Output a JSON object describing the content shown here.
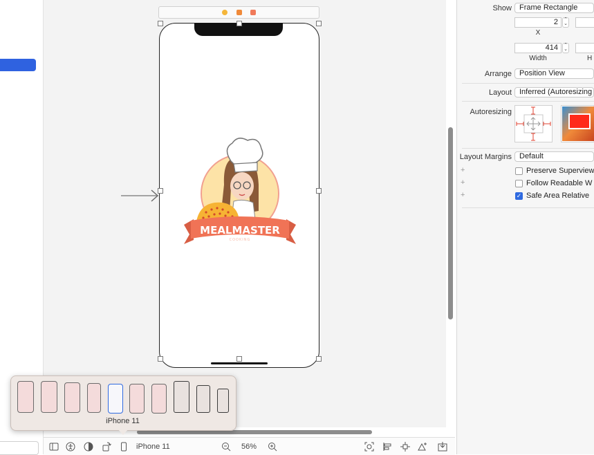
{
  "inspector": {
    "show_label": "Show",
    "show_value": "Frame Rectangle",
    "x_value": "2",
    "x_label": "X",
    "width_value": "414",
    "width_label": "Width",
    "arrange_label": "Arrange",
    "arrange_value": "Position View",
    "layout_label": "Layout",
    "layout_value": "Inferred (Autoresizing",
    "autoresizing_label": "Autoresizing",
    "layout_margins_label": "Layout Margins",
    "layout_margins_value": "Default",
    "checks": [
      {
        "label": "Preserve Superview",
        "checked": false
      },
      {
        "label": "Follow Readable W",
        "checked": false
      },
      {
        "label": "Safe Area Relative",
        "checked": true
      }
    ]
  },
  "canvas": {
    "logo_title": "MEALMASTER",
    "logo_subtitle": "COOKING"
  },
  "device_picker": {
    "selected_label": "iPhone 11"
  },
  "bottom_bar": {
    "device": "iPhone 11",
    "zoom": "56%"
  },
  "colors": {
    "accent": "#2f6ae0",
    "logo_banner": "#f07356",
    "preview_red": "#ff2a1a"
  }
}
